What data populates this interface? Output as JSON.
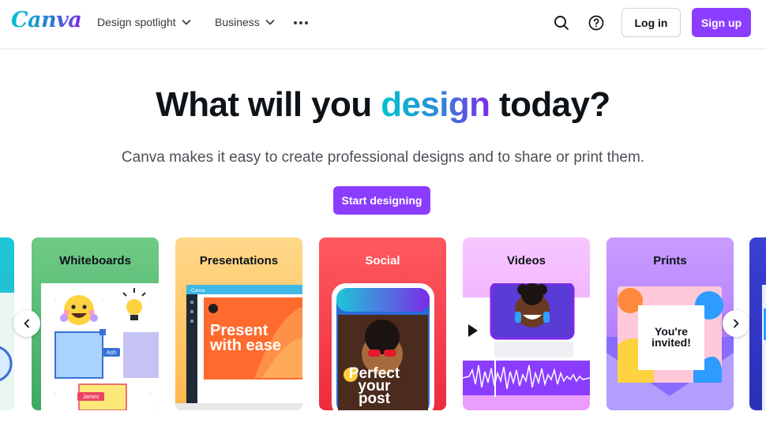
{
  "header": {
    "logo_text": "Canva",
    "nav": [
      {
        "label": "Design spotlight"
      },
      {
        "label": "Business"
      }
    ],
    "login_label": "Log in",
    "signup_label": "Sign up",
    "icons": [
      "search-icon",
      "help-icon",
      "more-icon"
    ]
  },
  "hero": {
    "title_before": "What will you ",
    "title_accent": "design",
    "title_after": " today?",
    "subtitle": "Canva makes it easy to create professional designs and to share or print them.",
    "cta_label": "Start designing"
  },
  "cards": [
    {
      "title": "Whiteboards",
      "tags": [
        "Ash",
        "James"
      ]
    },
    {
      "title": "Presentations",
      "mock_brand": "Canva",
      "art_text": [
        "Present",
        "with ease"
      ]
    },
    {
      "title": "Social",
      "art_text": [
        "Perfect",
        "your",
        "post"
      ]
    },
    {
      "title": "Videos"
    },
    {
      "title": "Prints",
      "art_text": [
        "You're",
        "invited!"
      ]
    }
  ],
  "colors": {
    "brand_purple": "#8b3dff",
    "accent_teal": "#00c4cc"
  }
}
